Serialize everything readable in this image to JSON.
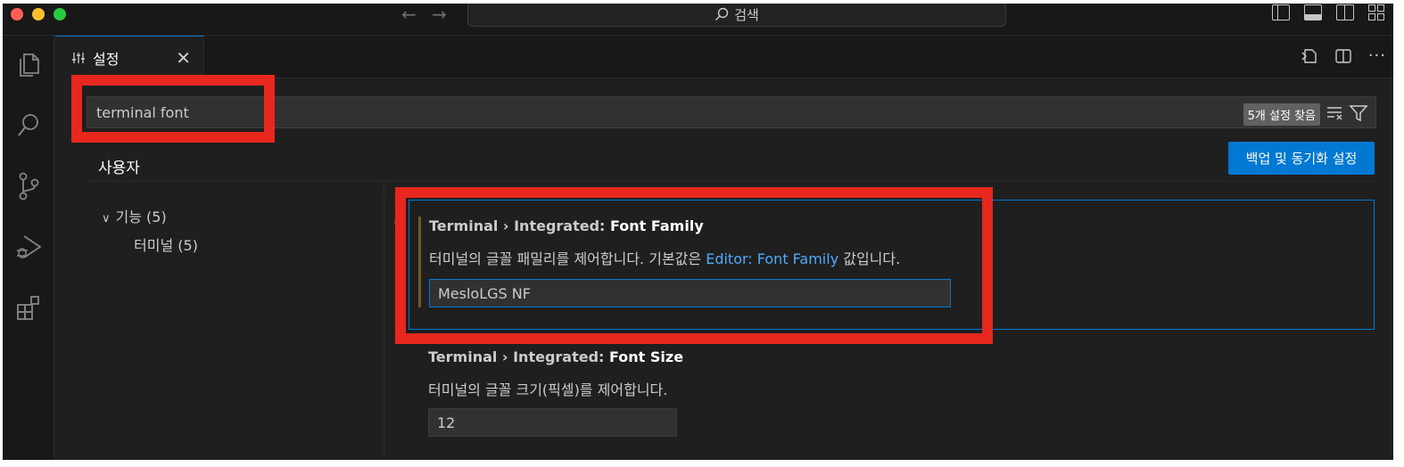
{
  "titlebar": {
    "search_label": "검색",
    "icons": [
      "arrow-left-icon",
      "arrow-right-icon",
      "search-icon",
      "toggle-sidebar-icon",
      "toggle-panel-icon",
      "toggle-secondary-sidebar-icon",
      "customize-layout-icon"
    ]
  },
  "activity_bar": {
    "items": [
      "explorer-icon",
      "search-icon",
      "source-control-icon",
      "run-debug-icon",
      "extensions-icon"
    ]
  },
  "tab": {
    "label": "설정",
    "icon": "settings-sliders-icon"
  },
  "search": {
    "value": "terminal font",
    "result_count": "5개 설정 찾음"
  },
  "scope": {
    "user_tab": "사용자",
    "sync_button": "백업 및 동기화 설정"
  },
  "toc": {
    "category": "기능 (5)",
    "subcategory": "터미널 (5)"
  },
  "settings": [
    {
      "category": "Terminal › Integrated: ",
      "name": "Font Family",
      "desc_before": "터미널의 글꼴 패밀리를 제어합니다. 기본값은 ",
      "desc_link": "Editor: Font Family",
      "desc_after": " 값입니다.",
      "value": "MesloLGS NF"
    },
    {
      "category": "Terminal › Integrated: ",
      "name": "Font Size",
      "desc": "터미널의 글꼴 크기(픽셀)를 제어합니다.",
      "value": "12"
    }
  ],
  "colors": {
    "accent": "#0078d4",
    "highlight": "#e8271e",
    "link": "#4daafc"
  }
}
